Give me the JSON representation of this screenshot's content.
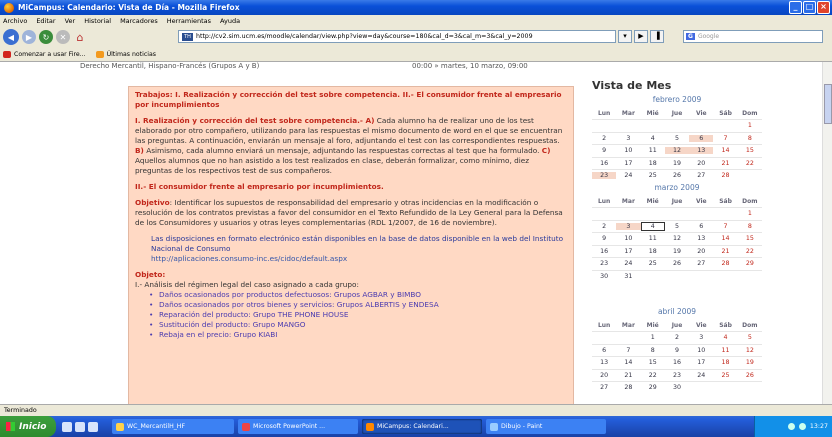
{
  "window": {
    "title": "MiCampus: Calendario: Vista de Día - Mozilla Firefox"
  },
  "menu": [
    "Archivo",
    "Editar",
    "Ver",
    "Historial",
    "Marcadores",
    "Herramientas",
    "Ayuda"
  ],
  "url": "http://cv2.sim.ucm.es/moodle/calendar/view.php?view=day&course=180&cal_d=3&cal_m=3&cal_y=2009",
  "search_placeholder": "Google",
  "bookmarks": [
    "Comenzar a usar Fire...",
    "Últimas noticias"
  ],
  "prev_event": {
    "course": "Derecho Mercantil, Hispano-Francés (Grupos A y B)",
    "time": "00:00 » martes, 10 marzo, 09:00"
  },
  "event": {
    "title": "Trabajos: I. Realización y corrección del test sobre competencia. II.- El consumidor frente al empresario por incumplimientos",
    "p1_heading": "I. Realización y corrección del test sobre competencia.- A)",
    "p1_text1": " Cada alumno ha de realizar uno de los test elaborado por otro compañero, utilizando para las respuestas el mismo documento de word en el que se encuentran las preguntas. A continuación, enviarán un mensaje al foro, adjuntando el test con las correspondientes respuestas. ",
    "p1_b": "B)",
    "p1_text2": " Asimismo, cada alumno enviará un mensaje, adjuntando las respuestas correctas al test que ha formulado. ",
    "p1_c": "C)",
    "p1_text3": " Aquellos alumnos que no han asistido a los test realizados en clase, deberán formalizar, como mínimo, diez preguntas de los respectivos test de sus compañeros.",
    "p2_heading": "II.- El consumidor frente al empresario por incumplimientos.",
    "objective_label": "Objetivo",
    "objective_text": ": Identificar los supuestos de responsabilidad del empresario y otras incidencias en la modificación o resolución de los contratos previstas a favor del consumidor en el Texto Refundido de la Ley General para la Defensa de los Consumidores y usuarios y otras leyes complementarias (RDL 1/2007, de 16 de noviembre).",
    "dispos_text": "Las disposiciones  en formato electrónico están disponibles en la base de datos disponible en la web del Instituto Nacional de Consumo",
    "dispos_link": "http://aplicaciones.consumo-inc.es/cidoc/default.aspx",
    "object_label": "Objeto",
    "object_intro": "I.- Análisis del régimen legal del caso asignado a cada grupo:",
    "cases": [
      "Daños ocasionados por productos defectuosos: Grupos AGBAR y BIMBO",
      "Daños ocasionados por otros bienes y servicios: Grupos ALBERTIS y ENDESA",
      "Reparación del producto: Grupo THE PHONE HOUSE",
      "Sustitución del producto: Grupo MANGO",
      "Rebaja en el precio: Grupo KIABI"
    ]
  },
  "sidebar": {
    "title": "Vista de Mes",
    "weekdays": [
      "Lun",
      "Mar",
      "Mié",
      "Jue",
      "Vie",
      "Sáb",
      "Dom"
    ],
    "months": [
      {
        "name": "febrero 2009",
        "weeks": [
          [
            "",
            "",
            "",
            "",
            "",
            "",
            "1"
          ],
          [
            "2",
            "3",
            "4",
            "5",
            "6",
            "7",
            "8"
          ],
          [
            "9",
            "10",
            "11",
            "12",
            "13",
            "14",
            "15"
          ],
          [
            "16",
            "17",
            "18",
            "19",
            "20",
            "21",
            "22"
          ],
          [
            "23",
            "24",
            "25",
            "26",
            "27",
            "28",
            ""
          ]
        ],
        "highlight": [
          "6",
          "12",
          "13",
          "23"
        ]
      },
      {
        "name": "marzo 2009",
        "weeks": [
          [
            "",
            "",
            "",
            "",
            "",
            "",
            "1"
          ],
          [
            "2",
            "3",
            "4",
            "5",
            "6",
            "7",
            "8"
          ],
          [
            "9",
            "10",
            "11",
            "12",
            "13",
            "14",
            "15"
          ],
          [
            "16",
            "17",
            "18",
            "19",
            "20",
            "21",
            "22"
          ],
          [
            "23",
            "24",
            "25",
            "26",
            "27",
            "28",
            "29"
          ],
          [
            "30",
            "31",
            "",
            "",
            "",
            "",
            ""
          ]
        ],
        "highlight": [
          "3"
        ],
        "selected": "4"
      },
      {
        "name": "abril 2009",
        "weeks": [
          [
            "",
            "",
            "1",
            "2",
            "3",
            "4",
            "5"
          ],
          [
            "6",
            "7",
            "8",
            "9",
            "10",
            "11",
            "12"
          ],
          [
            "13",
            "14",
            "15",
            "16",
            "17",
            "18",
            "19"
          ],
          [
            "20",
            "21",
            "22",
            "23",
            "24",
            "25",
            "26"
          ],
          [
            "27",
            "28",
            "29",
            "30",
            "",
            "",
            ""
          ]
        ],
        "highlight": []
      }
    ]
  },
  "status": "Terminado",
  "taskbar": {
    "start": "Inicio",
    "tasks": [
      "WC_MercantilH_HF",
      "Microsoft PowerPoint ...",
      "MiCampus: Calendari...",
      "Dibujo - Paint"
    ],
    "clock": "13:27"
  }
}
